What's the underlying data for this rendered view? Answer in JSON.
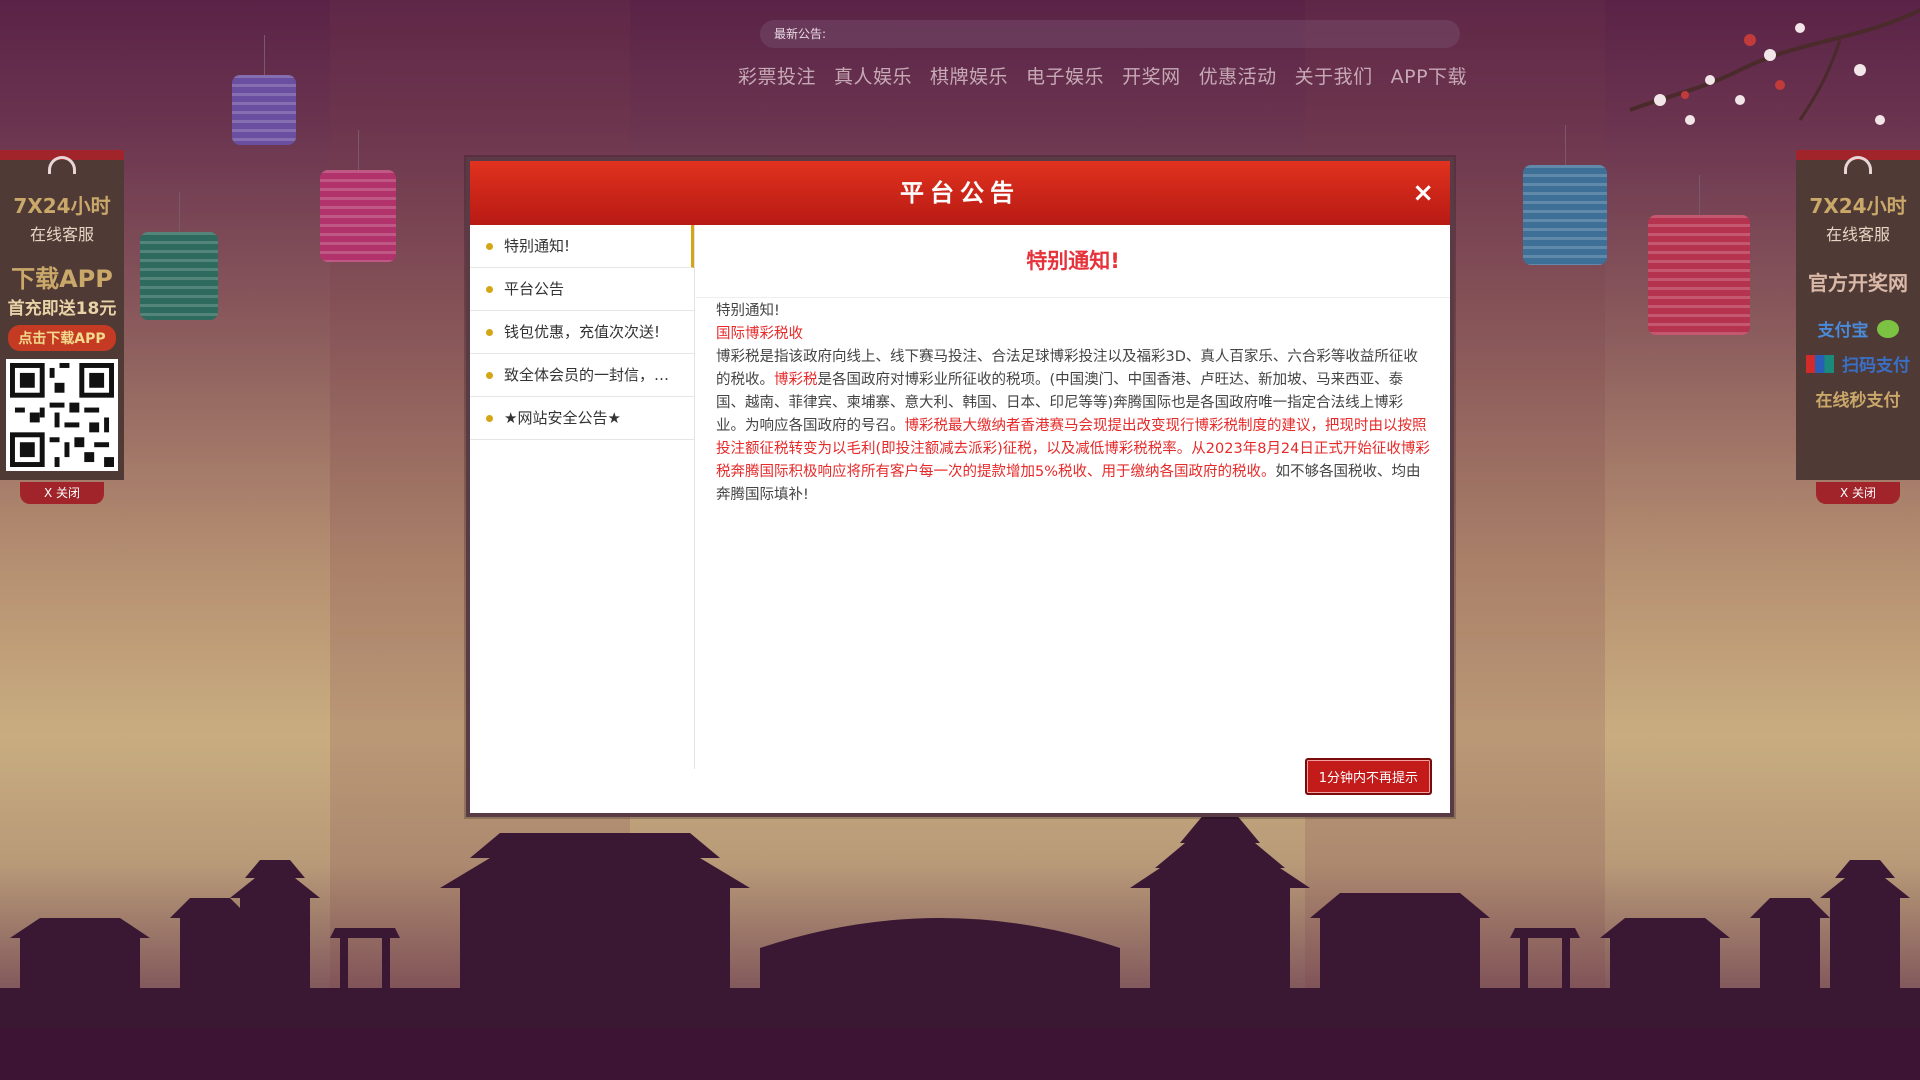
{
  "top": {
    "notice_label": "最新公告:",
    "nav": [
      "彩票投注",
      "真人娱乐",
      "棋牌娱乐",
      "电子娱乐",
      "开奖网",
      "优惠活动",
      "关于我们",
      "APP下载"
    ]
  },
  "left_panel": {
    "hours": "7X24小时",
    "service": "在线客服",
    "download": "下载APP",
    "bonus": "首充即送18元",
    "click_download": "点击下载APP",
    "close": "X 关闭"
  },
  "right_panel": {
    "hours": "7X24小时",
    "service": "在线客服",
    "official": "官方开奖网",
    "alipay": "支付宝",
    "scan_pay": "扫码支付",
    "online_pay": "在线秒支付",
    "close": "X 关闭"
  },
  "modal": {
    "title": "平台公告",
    "close_icon": "×",
    "tabs": [
      "特别通知!",
      "平台公告",
      "钱包优惠，充值次次送!",
      "致全体会员的一封信，…",
      "★网站安全公告★"
    ],
    "content_title": "特别通知!",
    "para_heading": "特别通知!",
    "red_heading": "国际博彩税收",
    "p1": "博彩税是指该政府向线上、线下赛马投注、合法足球博彩投注以及福彩3D、真人百家乐、六合彩等收益所征收的税收。",
    "p1_red": "博彩税",
    "p2": "是各国政府对博彩业所征收的税项。(中国澳门、中国香港、卢旺达、新加坡、马来西亚、泰国、越南、菲律宾、柬埔寨、意大利、韩国、日本、印尼等等)奔腾国际也是各国政府唯一指定合法线上博彩业。为响应各国政府的号召。",
    "p3_red": "博彩税最大缴纳者香港赛马会现提出改变现行博彩税制度的建议，把现时由以按照投注额征税转变为以毛利(即投注额减去派彩)征税，以及减低博彩税税率。从2023年8月24日正式开始征收博彩税奔腾国际积极响应将所有客户每一次的提款增加5%税收、用于缴纳各国政府的税收。",
    "p4": "如不够各国税收、均由奔腾国际填补!",
    "dismiss": "1分钟内不再提示"
  },
  "colors": {
    "header_red": "#c8221a",
    "accent_gold": "#d4a514",
    "text_red": "#e62a2a"
  }
}
